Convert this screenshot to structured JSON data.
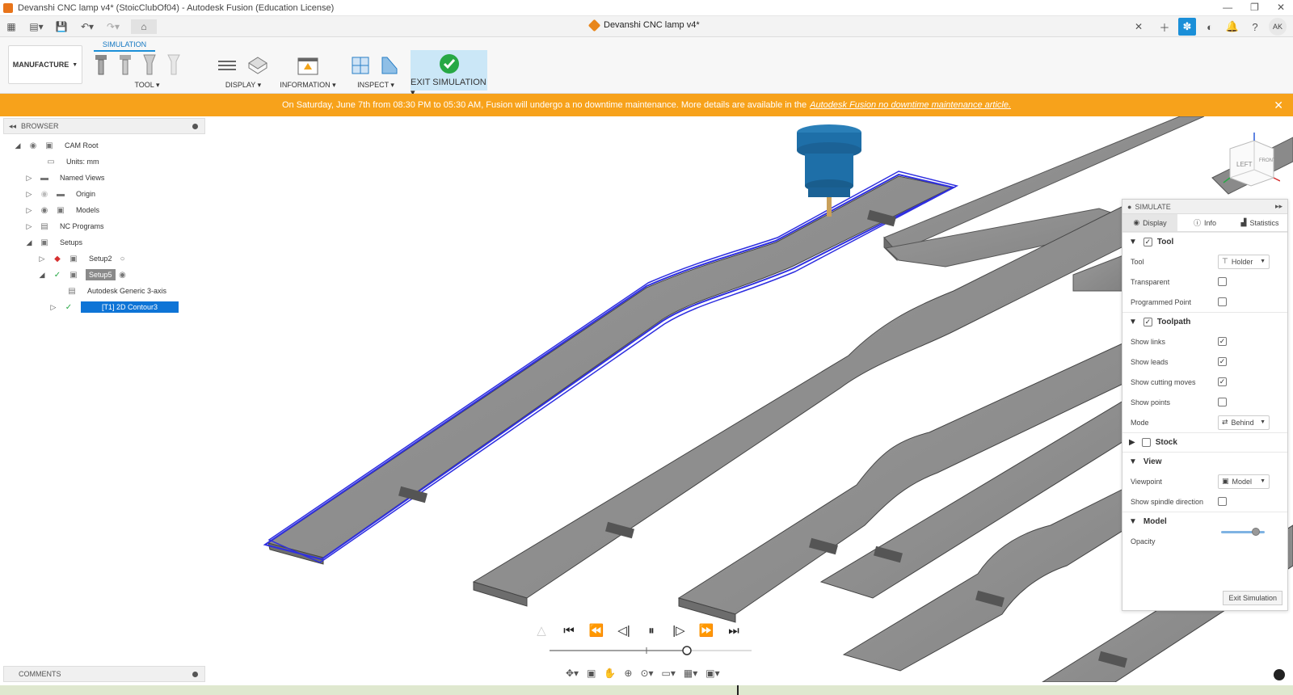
{
  "window": {
    "title": "Devanshi CNC lamp v4* (StoicClubOf04) - Autodesk Fusion (Education License)"
  },
  "document_tab": {
    "name": "Devanshi CNC lamp v4*"
  },
  "user_initials": "AK",
  "ribbon": {
    "active_tab": "SIMULATION",
    "workspace": "MANUFACTURE",
    "groups": [
      "TOOL",
      "DISPLAY",
      "INFORMATION",
      "INSPECT",
      "EXIT SIMULATION"
    ]
  },
  "banner": {
    "text": "On Saturday, June 7th from 08:30 PM to 05:30 AM, Fusion will undergo a no downtime maintenance. More details are available in the",
    "link": "Autodesk Fusion no downtime maintenance article."
  },
  "browser": {
    "title": "BROWSER",
    "items": [
      {
        "label": "CAM Root"
      },
      {
        "label": "Units: mm"
      },
      {
        "label": "Named Views"
      },
      {
        "label": "Origin"
      },
      {
        "label": "Models"
      },
      {
        "label": "NC Programs"
      },
      {
        "label": "Setups"
      },
      {
        "label": "Setup2"
      },
      {
        "label": "Setup5"
      },
      {
        "label": "Autodesk Generic 3-axis"
      },
      {
        "label": "[T1] 2D Contour3"
      }
    ]
  },
  "comments": {
    "title": "COMMENTS"
  },
  "simulate_panel": {
    "title": "SIMULATE",
    "tabs": [
      "Display",
      "Info",
      "Statistics"
    ],
    "tool_section": "Tool",
    "tool_label": "Tool",
    "tool_value": "Holder",
    "transparent": "Transparent",
    "programmed_point": "Programmed Point",
    "toolpath_section": "Toolpath",
    "show_links": "Show links",
    "show_leads": "Show leads",
    "show_cutting_moves": "Show cutting moves",
    "show_points": "Show points",
    "mode_label": "Mode",
    "mode_value": "Behind",
    "stock_section": "Stock",
    "view_section": "View",
    "viewpoint_label": "Viewpoint",
    "viewpoint_value": "Model",
    "show_spindle_direction": "Show spindle direction",
    "model_section": "Model",
    "opacity_label": "Opacity",
    "exit_button": "Exit Simulation",
    "opacity_fraction": 0.8
  },
  "viewcube": {
    "face_left": "LEFT",
    "face_front": "FRONT"
  },
  "colors": {
    "banner": "#f7a21b",
    "toolpath": "#2f2fe0",
    "part": "#8f8f8f",
    "tool": "#1e6fa8",
    "selection": "#0e74d6"
  }
}
